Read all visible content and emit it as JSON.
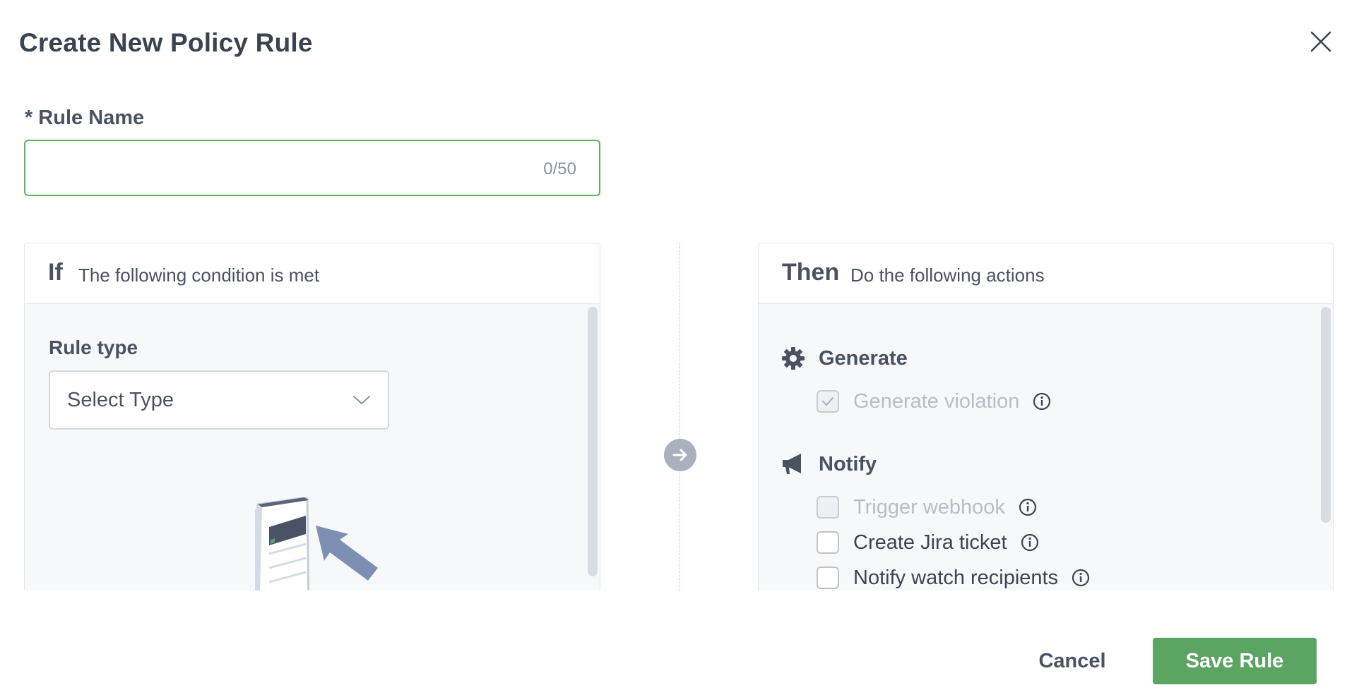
{
  "dialog": {
    "title": "Create New Policy Rule"
  },
  "rule_name": {
    "required_marker": "*",
    "label": "Rule Name",
    "value": "",
    "placeholder": "",
    "counter": "0/50"
  },
  "condition_panel": {
    "keyword": "If",
    "description": "The following condition is met",
    "rule_type_label": "Rule type",
    "select_value": "Select Type"
  },
  "actions_panel": {
    "keyword": "Then",
    "description": "Do the following actions",
    "sections": [
      {
        "title": "Generate",
        "icon": "gear-icon",
        "items": [
          {
            "label": "Generate violation",
            "checked": true,
            "disabled": true
          }
        ]
      },
      {
        "title": "Notify",
        "icon": "megaphone-icon",
        "items": [
          {
            "label": "Trigger webhook",
            "checked": false,
            "disabled": true
          },
          {
            "label": "Create Jira ticket",
            "checked": false,
            "disabled": false
          },
          {
            "label": "Notify watch recipients",
            "checked": false,
            "disabled": false
          }
        ]
      }
    ]
  },
  "footer": {
    "cancel_label": "Cancel",
    "save_label": "Save Rule"
  },
  "colors": {
    "accent_green": "#5ba461",
    "input_focus_border": "#5cb25d",
    "text_primary": "#3d4451",
    "text_disabled": "#b9bec6",
    "panel_bg": "#f7f8fa"
  }
}
